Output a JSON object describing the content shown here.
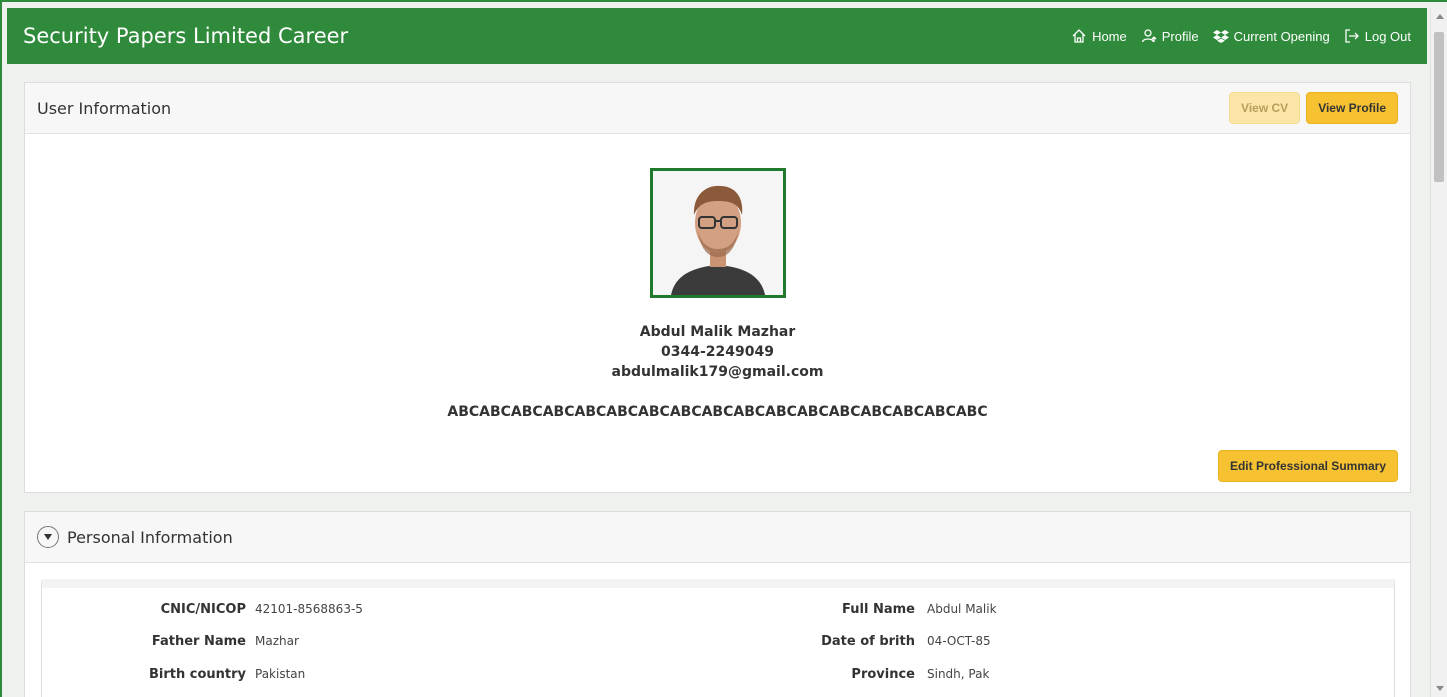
{
  "header": {
    "brand": "Security Papers Limited Career",
    "nav": [
      {
        "label": "Home",
        "icon": "home-icon"
      },
      {
        "label": "Profile",
        "icon": "user-icon"
      },
      {
        "label": "Current Opening",
        "icon": "dropbox-icon"
      },
      {
        "label": "Log Out",
        "icon": "logout-icon"
      }
    ]
  },
  "user_card": {
    "title": "User Information",
    "view_cv": "View CV",
    "view_profile": "View Profile",
    "name": "Abdul Malik Mazhar",
    "phone": "0344-2249049",
    "email": "abdulmalik179@gmail.com",
    "summary": "ABCABCABCABCABCABCABCABCABCABCABCABCABCABCABCABCABC",
    "edit_summary": "Edit Professional Summary"
  },
  "personal": {
    "title": "Personal Information",
    "rows": [
      {
        "l_label": "CNIC/NICOP",
        "l_value": "42101-8568863-5",
        "r_label": "Full Name",
        "r_value": "Abdul Malik"
      },
      {
        "l_label": "Father Name",
        "l_value": "Mazhar",
        "r_label": "Date of brith",
        "r_value": "04-OCT-85"
      },
      {
        "l_label": "Birth country",
        "l_value": "Pakistan",
        "r_label": "Province",
        "r_value": "Sindh, Pak"
      }
    ]
  },
  "colors": {
    "brand_green": "#2f8a3b",
    "accent_yellow": "#f7c232"
  }
}
